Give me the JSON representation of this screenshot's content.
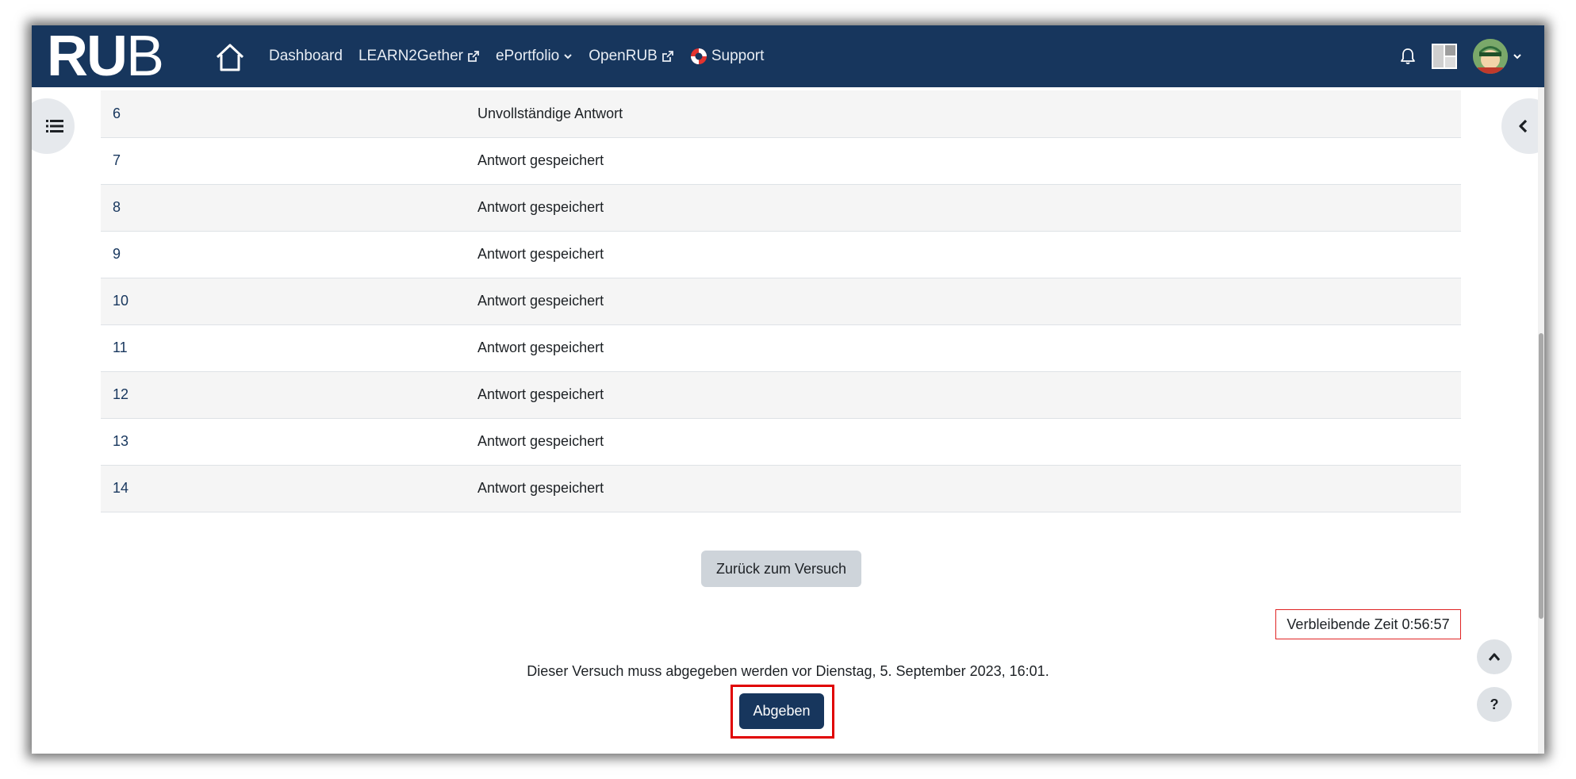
{
  "navbar": {
    "logo": {
      "part1": "RU",
      "part2": "B"
    },
    "links": [
      {
        "label": "Dashboard",
        "icon": ""
      },
      {
        "label": "LEARN2Gether",
        "icon": "external-link-icon"
      },
      {
        "label": "ePortfolio",
        "icon": "chevron-down-icon"
      },
      {
        "label": "OpenRUB",
        "icon": "external-link-icon"
      },
      {
        "label": "Support",
        "icon": "lifebuoy-icon"
      }
    ],
    "colors": {
      "background": "#17365d",
      "text": "#e8edf4"
    }
  },
  "summary": {
    "rows": [
      {
        "question": "6",
        "status": "Unvollständige Antwort"
      },
      {
        "question": "7",
        "status": "Antwort gespeichert"
      },
      {
        "question": "8",
        "status": "Antwort gespeichert"
      },
      {
        "question": "9",
        "status": "Antwort gespeichert"
      },
      {
        "question": "10",
        "status": "Antwort gespeichert"
      },
      {
        "question": "11",
        "status": "Antwort gespeichert"
      },
      {
        "question": "12",
        "status": "Antwort gespeichert"
      },
      {
        "question": "13",
        "status": "Antwort gespeichert"
      },
      {
        "question": "14",
        "status": "Antwort gespeichert"
      }
    ]
  },
  "actions": {
    "back_label": "Zurück zum Versuch",
    "timer_text": "Verbleibende Zeit 0:56:57",
    "deadline_text": "Dieser Versuch muss abgegeben werden vor Dienstag, 5. September 2023, 16:01.",
    "submit_label": "Abgeben",
    "help_label": "?"
  },
  "colors": {
    "accent": "#17365d",
    "highlight": "#e00000",
    "secondary_button": "#ced4da"
  }
}
